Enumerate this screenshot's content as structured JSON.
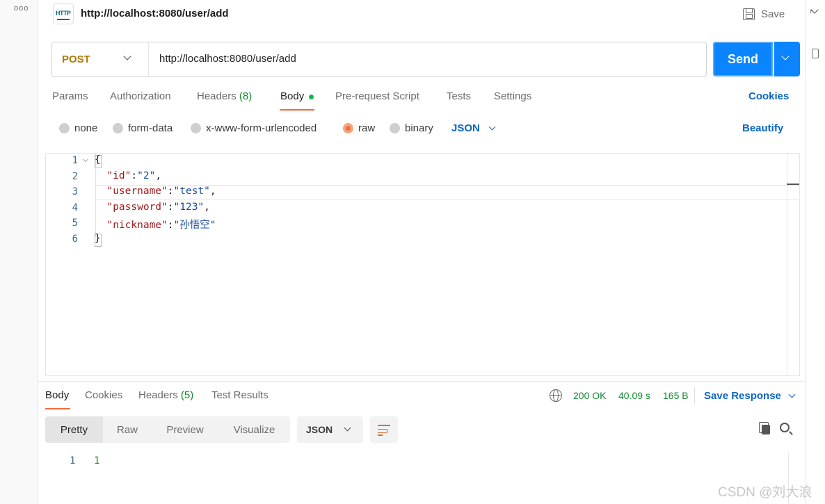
{
  "header": {
    "title": "http://localhost:8080/user/add",
    "icon_label": "HTTP",
    "save_label": "Save"
  },
  "request": {
    "method": "POST",
    "url": "http://localhost:8080/user/add",
    "send_label": "Send"
  },
  "tabs": [
    {
      "label": "Params"
    },
    {
      "label": "Authorization"
    },
    {
      "label": "Headers",
      "count": "(8)"
    },
    {
      "label": "Body"
    },
    {
      "label": "Pre-request Script"
    },
    {
      "label": "Tests"
    },
    {
      "label": "Settings"
    }
  ],
  "cookies_label": "Cookies",
  "body_types": {
    "options": [
      "none",
      "form-data",
      "x-www-form-urlencoded",
      "raw",
      "binary"
    ],
    "selected": "raw",
    "format": "JSON",
    "beautify_label": "Beautify"
  },
  "editor": {
    "line_numbers": [
      "1",
      "2",
      "3",
      "4",
      "5",
      "6"
    ],
    "lines": [
      {
        "text": "{"
      },
      {
        "key": "\"id\"",
        "sep": ":",
        "val": "\"2\"",
        "end": ","
      },
      {
        "key": "\"username\"",
        "sep": ":",
        "val": "\"test\"",
        "end": ","
      },
      {
        "key": "\"password\"",
        "sep": ":",
        "val": "\"123\"",
        "end": ","
      },
      {
        "key": "\"nickname\"",
        "sep": ":",
        "val": "\"孙悟空\"",
        "end": ""
      },
      {
        "text": "}"
      }
    ]
  },
  "response": {
    "tabs": [
      {
        "label": "Body"
      },
      {
        "label": "Cookies"
      },
      {
        "label": "Headers",
        "count": "(5)"
      },
      {
        "label": "Test Results"
      }
    ],
    "status": "200 OK",
    "time": "40.09 s",
    "size": "165 B",
    "save_response_label": "Save Response",
    "views": [
      "Pretty",
      "Raw",
      "Preview",
      "Visualize"
    ],
    "format": "JSON",
    "line_number": "1",
    "content": "1"
  },
  "watermark": "CSDN @刘大浪",
  "colors": {
    "accent": "#0a84ff",
    "tab_active": "#f26b3a",
    "method": "#ad7a03",
    "success": "#0f8a2c",
    "link": "#0a66c2"
  },
  "icons": [
    "http-icon",
    "save-icon",
    "chevron-down-icon",
    "globe-icon",
    "copy-icon",
    "search-icon",
    "wrap-lines-icon",
    "more-dots-icon"
  ]
}
